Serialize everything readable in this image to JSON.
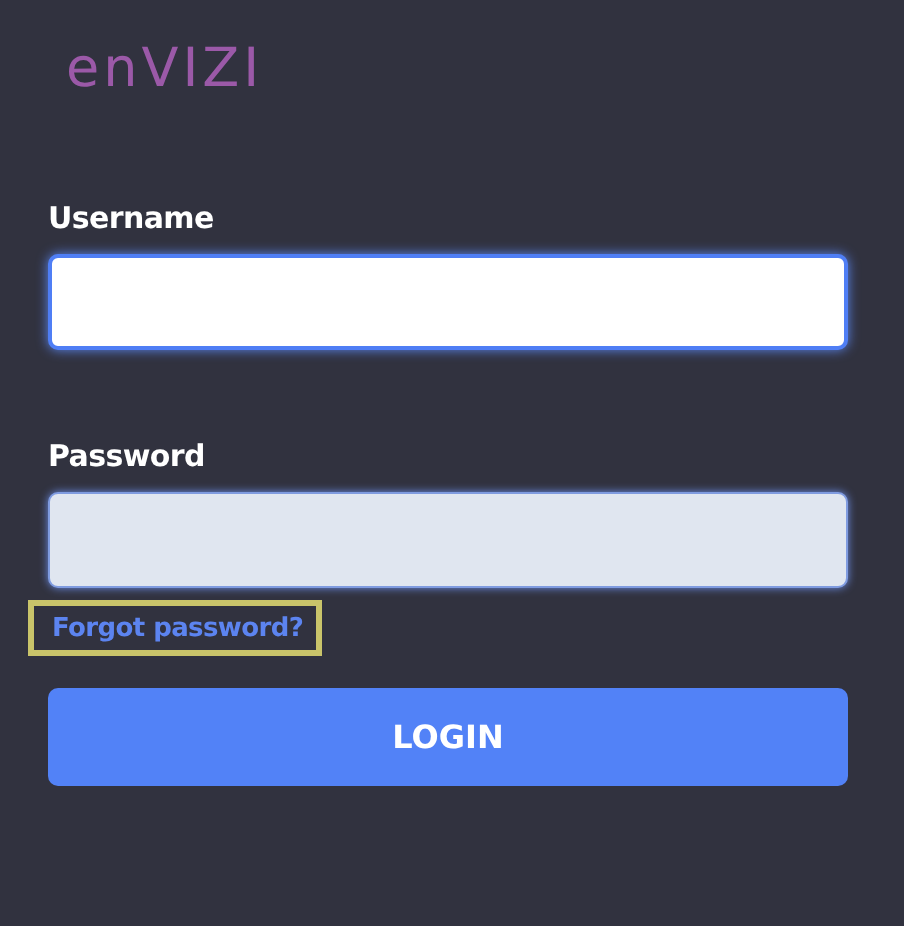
{
  "logo": {
    "text": "enVIZI"
  },
  "fields": [
    {
      "label": "Username",
      "focused": true
    },
    {
      "label": "Password",
      "focused": false
    }
  ],
  "forgot_link": {
    "text": "Forgot password?",
    "highlighted": true
  },
  "login_button": {
    "label": "LOGIN"
  }
}
